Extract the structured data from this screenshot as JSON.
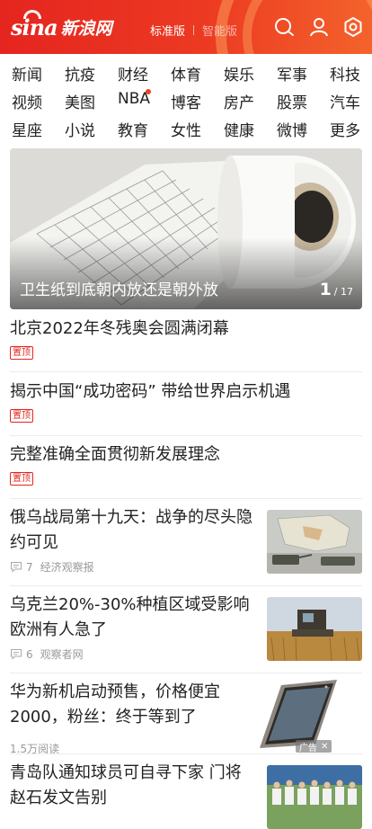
{
  "header": {
    "logo_latin": "sina",
    "logo_cn": "新浪网",
    "version_standard": "标准版",
    "version_smart": "智能版",
    "colors": {
      "brand": "#e5251f",
      "accent": "#f4632b"
    },
    "icons": [
      "search-icon",
      "user-icon",
      "settings-icon"
    ]
  },
  "categories": [
    [
      "新闻",
      "抗疫",
      "财经",
      "体育",
      "娱乐",
      "军事",
      "科技"
    ],
    [
      "视频",
      "美图",
      "NBA",
      "博客",
      "房产",
      "股票",
      "汽车"
    ],
    [
      "星座",
      "小说",
      "教育",
      "女性",
      "健康",
      "微博",
      "更多"
    ]
  ],
  "hero": {
    "caption": "卫生纸到底朝内放还是朝外放",
    "current": "1",
    "total": "/ 17"
  },
  "pinned": {
    "label": "置顶",
    "items": [
      "北京2022年冬残奥会圆满闭幕",
      "揭示中国“成功密码” 带给世界启示机遇",
      "完整准确全面贯彻新发展理念"
    ]
  },
  "news": [
    {
      "title": "俄乌战局第十九天：战争的尽头隐约可见",
      "comments": "7",
      "source": "经济观察报"
    },
    {
      "title": "乌克兰20%-30%种植区域受影响欧洲有人急了",
      "comments": "6",
      "source": "观察者网"
    },
    {
      "title": "华为新机启动预售，价格便宜2000，粉丝：终于等到了",
      "reads": "1.5万阅读",
      "ad_label": "广告"
    },
    {
      "title": "青岛队通知球员可自寻下家 门将赵石发文告别"
    }
  ]
}
